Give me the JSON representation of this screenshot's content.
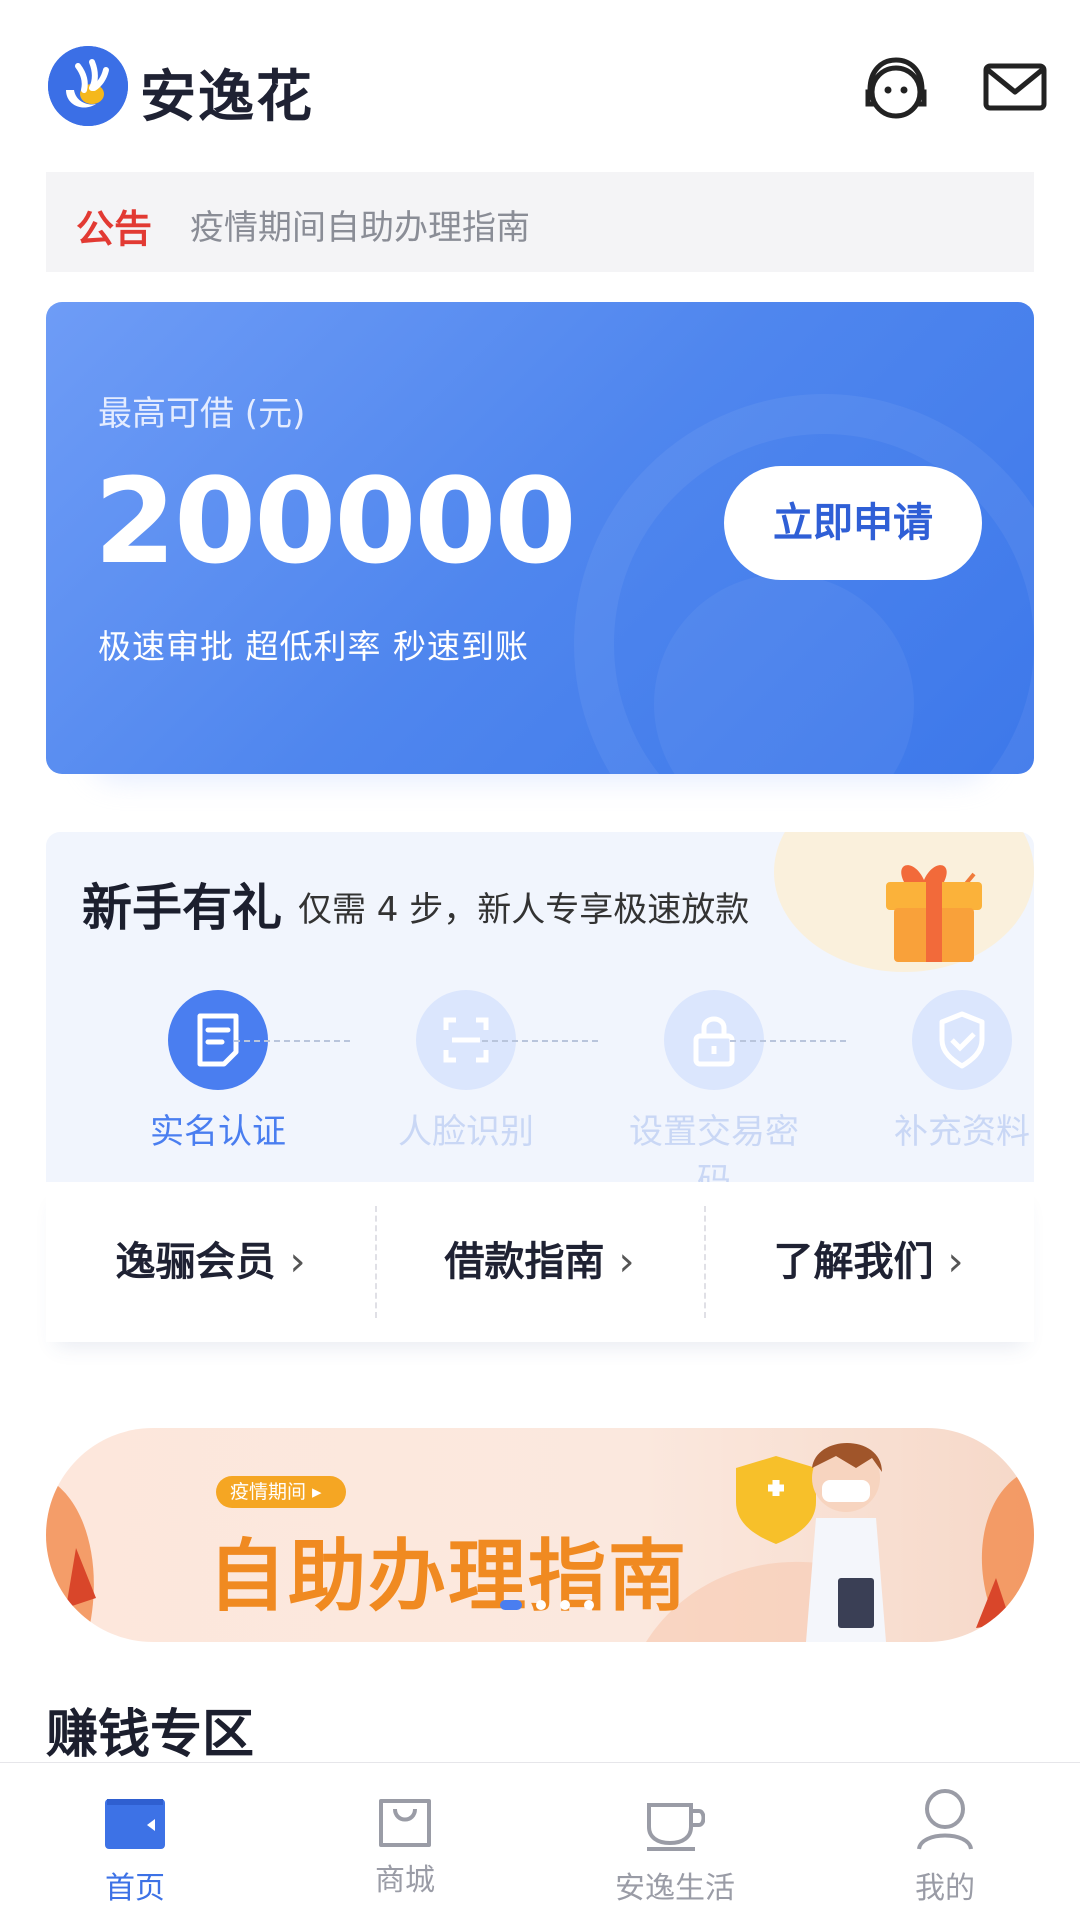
{
  "header": {
    "brand_name": "安逸花",
    "icons": [
      "customer-service-icon",
      "mail-icon"
    ]
  },
  "notice": {
    "tag": "公告",
    "text": "疫情期间自助办理指南"
  },
  "loan_card": {
    "label": "最高可借 (元)",
    "amount": "200000",
    "slogan": "极速审批 超低利率 秒速到账",
    "apply_button": "立即申请"
  },
  "newbie": {
    "title": "新手有礼",
    "subtitle": "仅需 4 步，新人专享极速放款",
    "steps": [
      {
        "label": "实名认证",
        "icon": "document-icon",
        "active": true
      },
      {
        "label": "人脸识别",
        "icon": "face-scan-icon",
        "active": false
      },
      {
        "label": "设置交易密码",
        "icon": "lock-icon",
        "active": false
      },
      {
        "label": "补充资料",
        "icon": "shield-check-icon",
        "active": false
      }
    ]
  },
  "quick_links": [
    {
      "label": "逸骊会员"
    },
    {
      "label": "借款指南"
    },
    {
      "label": "了解我们"
    }
  ],
  "banner": {
    "tag": "疫情期间",
    "title": "自助办理指南",
    "page_count": 4,
    "current_page": 1
  },
  "section": {
    "title": "赚钱专区"
  },
  "tabbar": {
    "tabs": [
      {
        "label": "首页",
        "icon": "wallet-icon",
        "active": true
      },
      {
        "label": "商城",
        "icon": "shopping-bag-icon",
        "active": false
      },
      {
        "label": "安逸生活",
        "icon": "coffee-cup-icon",
        "active": false
      },
      {
        "label": "我的",
        "icon": "user-icon",
        "active": false
      }
    ]
  },
  "colors": {
    "accent": "#3d72e6",
    "notice_tag": "#e23a33",
    "banner_title": "#f08a21"
  }
}
